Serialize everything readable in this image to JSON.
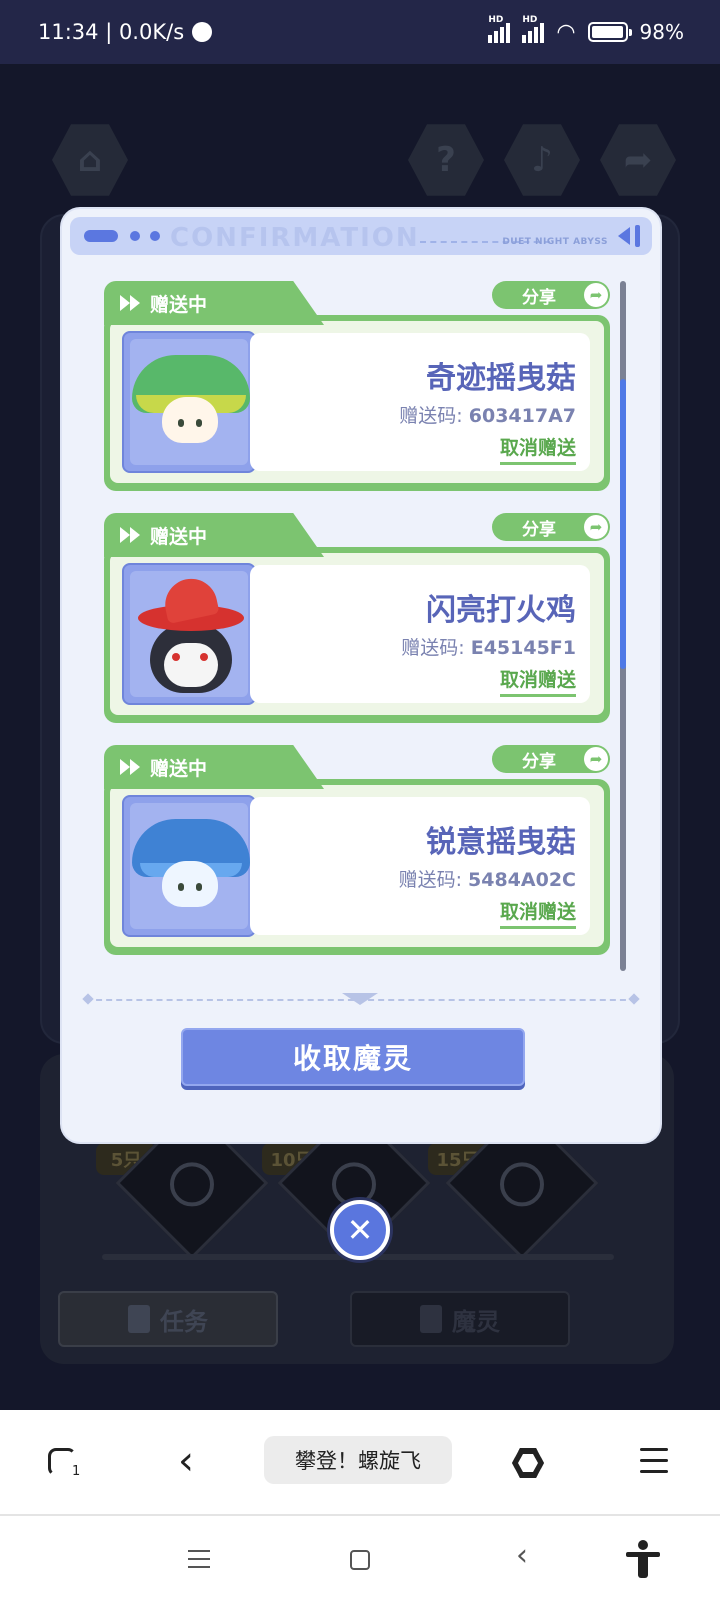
{
  "status_bar": {
    "time_speed": "11:34 | 0.0K/s",
    "sim1_label": "HD",
    "sim2_label": "HD",
    "battery": "98%"
  },
  "background": {
    "reward_tags": [
      "5只",
      "10只",
      "15只"
    ],
    "task_button": "任务",
    "spirit_button": "魔灵"
  },
  "modal": {
    "header_watermark": "CONFIRMATION",
    "brand": "DUET NIGHT ABYSS",
    "code_prefix": "赠送码: ",
    "items": [
      {
        "status": "赠送中",
        "share": "分享",
        "name": "奇迹摇曳菇",
        "code": "603417A7",
        "cancel": "取消赠送",
        "creature": "green-mushroom"
      },
      {
        "status": "赠送中",
        "share": "分享",
        "name": "闪亮打火鸡",
        "code": "E45145F1",
        "cancel": "取消赠送",
        "creature": "fire-bird"
      },
      {
        "status": "赠送中",
        "share": "分享",
        "name": "锐意摇曳菇",
        "code": "5484A02C",
        "cancel": "取消赠送",
        "creature": "blue-mushroom"
      }
    ],
    "collect_button": "收取魔灵",
    "close_glyph": "✕"
  },
  "browser": {
    "tab_count": "1",
    "url_title": "攀登！螺旋飞"
  },
  "colors": {
    "accent_green": "#7cc470",
    "accent_blue": "#6e86e2",
    "title_purple": "#5865b8"
  }
}
